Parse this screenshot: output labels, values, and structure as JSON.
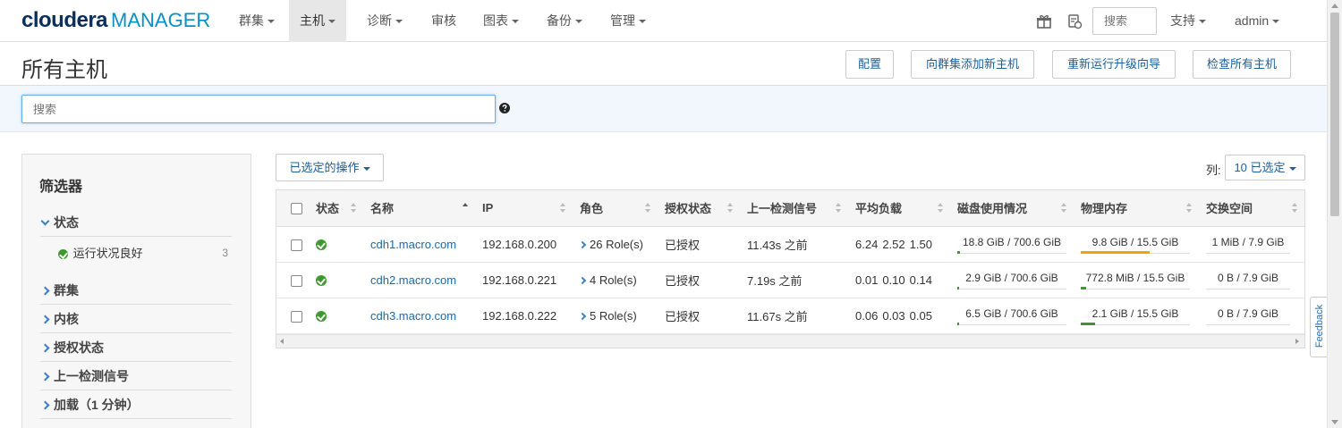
{
  "brand": {
    "name": "cloudera",
    "product": "MANAGER"
  },
  "nav": {
    "items": [
      {
        "label": "群集",
        "dropdown": true
      },
      {
        "label": "主机",
        "dropdown": true,
        "active": true
      },
      {
        "label": "诊断",
        "dropdown": true
      },
      {
        "label": "审核",
        "dropdown": false
      },
      {
        "label": "图表",
        "dropdown": true
      },
      {
        "label": "备份",
        "dropdown": true
      },
      {
        "label": "管理",
        "dropdown": true
      }
    ],
    "search_placeholder": "搜索",
    "support_label": "支持",
    "user_label": "admin",
    "icons": [
      "gift-icon",
      "running-commands-icon"
    ]
  },
  "page": {
    "title": "所有主机",
    "buttons": {
      "configure": "配置",
      "add_hosts": "向群集添加新主机",
      "rerun_upgrade": "重新运行升级向导",
      "inspect_all": "检查所有主机"
    },
    "search_placeholder": "搜索"
  },
  "filters": {
    "title": "筛选器",
    "groups": [
      {
        "label": "状态",
        "expanded": true
      },
      {
        "label": "群集"
      },
      {
        "label": "内核"
      },
      {
        "label": "授权状态"
      },
      {
        "label": "上一检测信号"
      },
      {
        "label": "加载（1 分钟）"
      }
    ],
    "status_options": [
      {
        "label": "运行状况良好",
        "count": "3"
      }
    ]
  },
  "toolbar": {
    "selected_actions": "已选定的操作",
    "columns_label": "列:",
    "columns_selected": "10 已选定"
  },
  "table": {
    "headers": [
      "状态",
      "名称",
      "IP",
      "角色",
      "授权状态",
      "上一检测信号",
      "平均负载",
      "磁盘使用情况",
      "物理内存",
      "交换空间"
    ],
    "rows": [
      {
        "name": "cdh1.macro.com",
        "ip": "192.168.0.200",
        "roles": "26 Role(s)",
        "commission": "已授权",
        "heartbeat": "11.43s 之前",
        "load": [
          "6.24",
          "2.52",
          "1.50"
        ],
        "disk": "18.8 GiB / 700.6 GiB",
        "disk_pct": 2.7,
        "memory": "9.8 GiB / 15.5 GiB",
        "memory_pct": 63,
        "memory_status": "warn",
        "swap": "1 MiB / 7.9 GiB",
        "swap_pct": 0
      },
      {
        "name": "cdh2.macro.com",
        "ip": "192.168.0.221",
        "roles": "4 Role(s)",
        "commission": "已授权",
        "heartbeat": "7.19s 之前",
        "load": [
          "0.01",
          "0.10",
          "0.14"
        ],
        "disk": "2.9 GiB / 700.6 GiB",
        "disk_pct": 0.4,
        "memory": "772.8 MiB / 15.5 GiB",
        "memory_pct": 4.9,
        "memory_status": "ok",
        "swap": "0 B / 7.9 GiB",
        "swap_pct": 0
      },
      {
        "name": "cdh3.macro.com",
        "ip": "192.168.0.222",
        "roles": "5 Role(s)",
        "commission": "已授权",
        "heartbeat": "11.67s 之前",
        "load": [
          "0.06",
          "0.03",
          "0.05"
        ],
        "disk": "6.5 GiB / 700.6 GiB",
        "disk_pct": 0.9,
        "memory": "2.1 GiB / 15.5 GiB",
        "memory_pct": 13.5,
        "memory_status": "ok",
        "swap": "0 B / 7.9 GiB",
        "swap_pct": 0
      }
    ]
  },
  "feedback": "Feedback",
  "colors": {
    "accent": "#1a6aa8",
    "ok": "#3c9a2d",
    "warn": "#f0a30a",
    "brand_dark": "#0a2f5c",
    "brand_light": "#0a8fc7"
  }
}
